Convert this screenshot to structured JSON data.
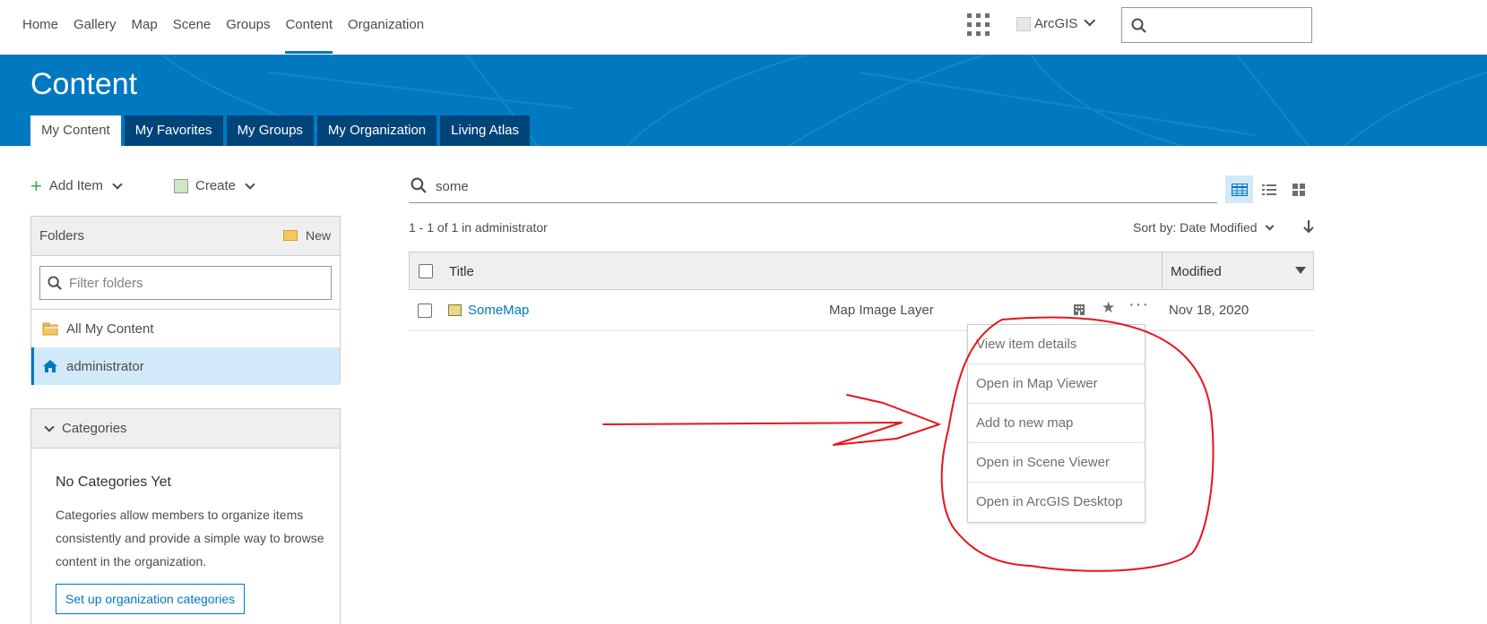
{
  "nav": {
    "links": [
      "Home",
      "Gallery",
      "Map",
      "Scene",
      "Groups",
      "Content",
      "Organization"
    ],
    "active": "Content",
    "user_label": "ArcGIS",
    "search_placeholder": ""
  },
  "banner": {
    "title": "Content",
    "tabs": [
      "My Content",
      "My Favorites",
      "My Groups",
      "My Organization",
      "Living Atlas"
    ],
    "active_tab": "My Content",
    "color": "#0079c1"
  },
  "toolbar": {
    "add_item": "Add Item",
    "create": "Create"
  },
  "folders": {
    "title": "Folders",
    "new_label": "New",
    "filter_placeholder": "Filter folders",
    "items": [
      "All My Content",
      "administrator"
    ],
    "selected": "administrator"
  },
  "categories": {
    "title": "Categories",
    "empty_title": "No Categories Yet",
    "description": "Categories allow members to organize items consistently and provide a simple way to browse content in the organization.",
    "setup_button": "Set up organization categories"
  },
  "search": {
    "query": "some"
  },
  "results": {
    "count_text": "1 - 1 of 1 in administrator",
    "sort_label": "Sort by: Date Modified",
    "columns": {
      "title": "Title",
      "modified": "Modified"
    },
    "rows": [
      {
        "name": "SomeMap",
        "type": "Map Image Layer",
        "date": "Nov 18, 2020"
      }
    ]
  },
  "context_menu": {
    "items": [
      "View item details",
      "Open in Map Viewer",
      "Add to new map",
      "Open in Scene Viewer",
      "Open in ArcGIS Desktop"
    ]
  },
  "colors": {
    "accent": "#0079c1",
    "annotation": "#e8141c",
    "tab_dark": "#00457a"
  }
}
